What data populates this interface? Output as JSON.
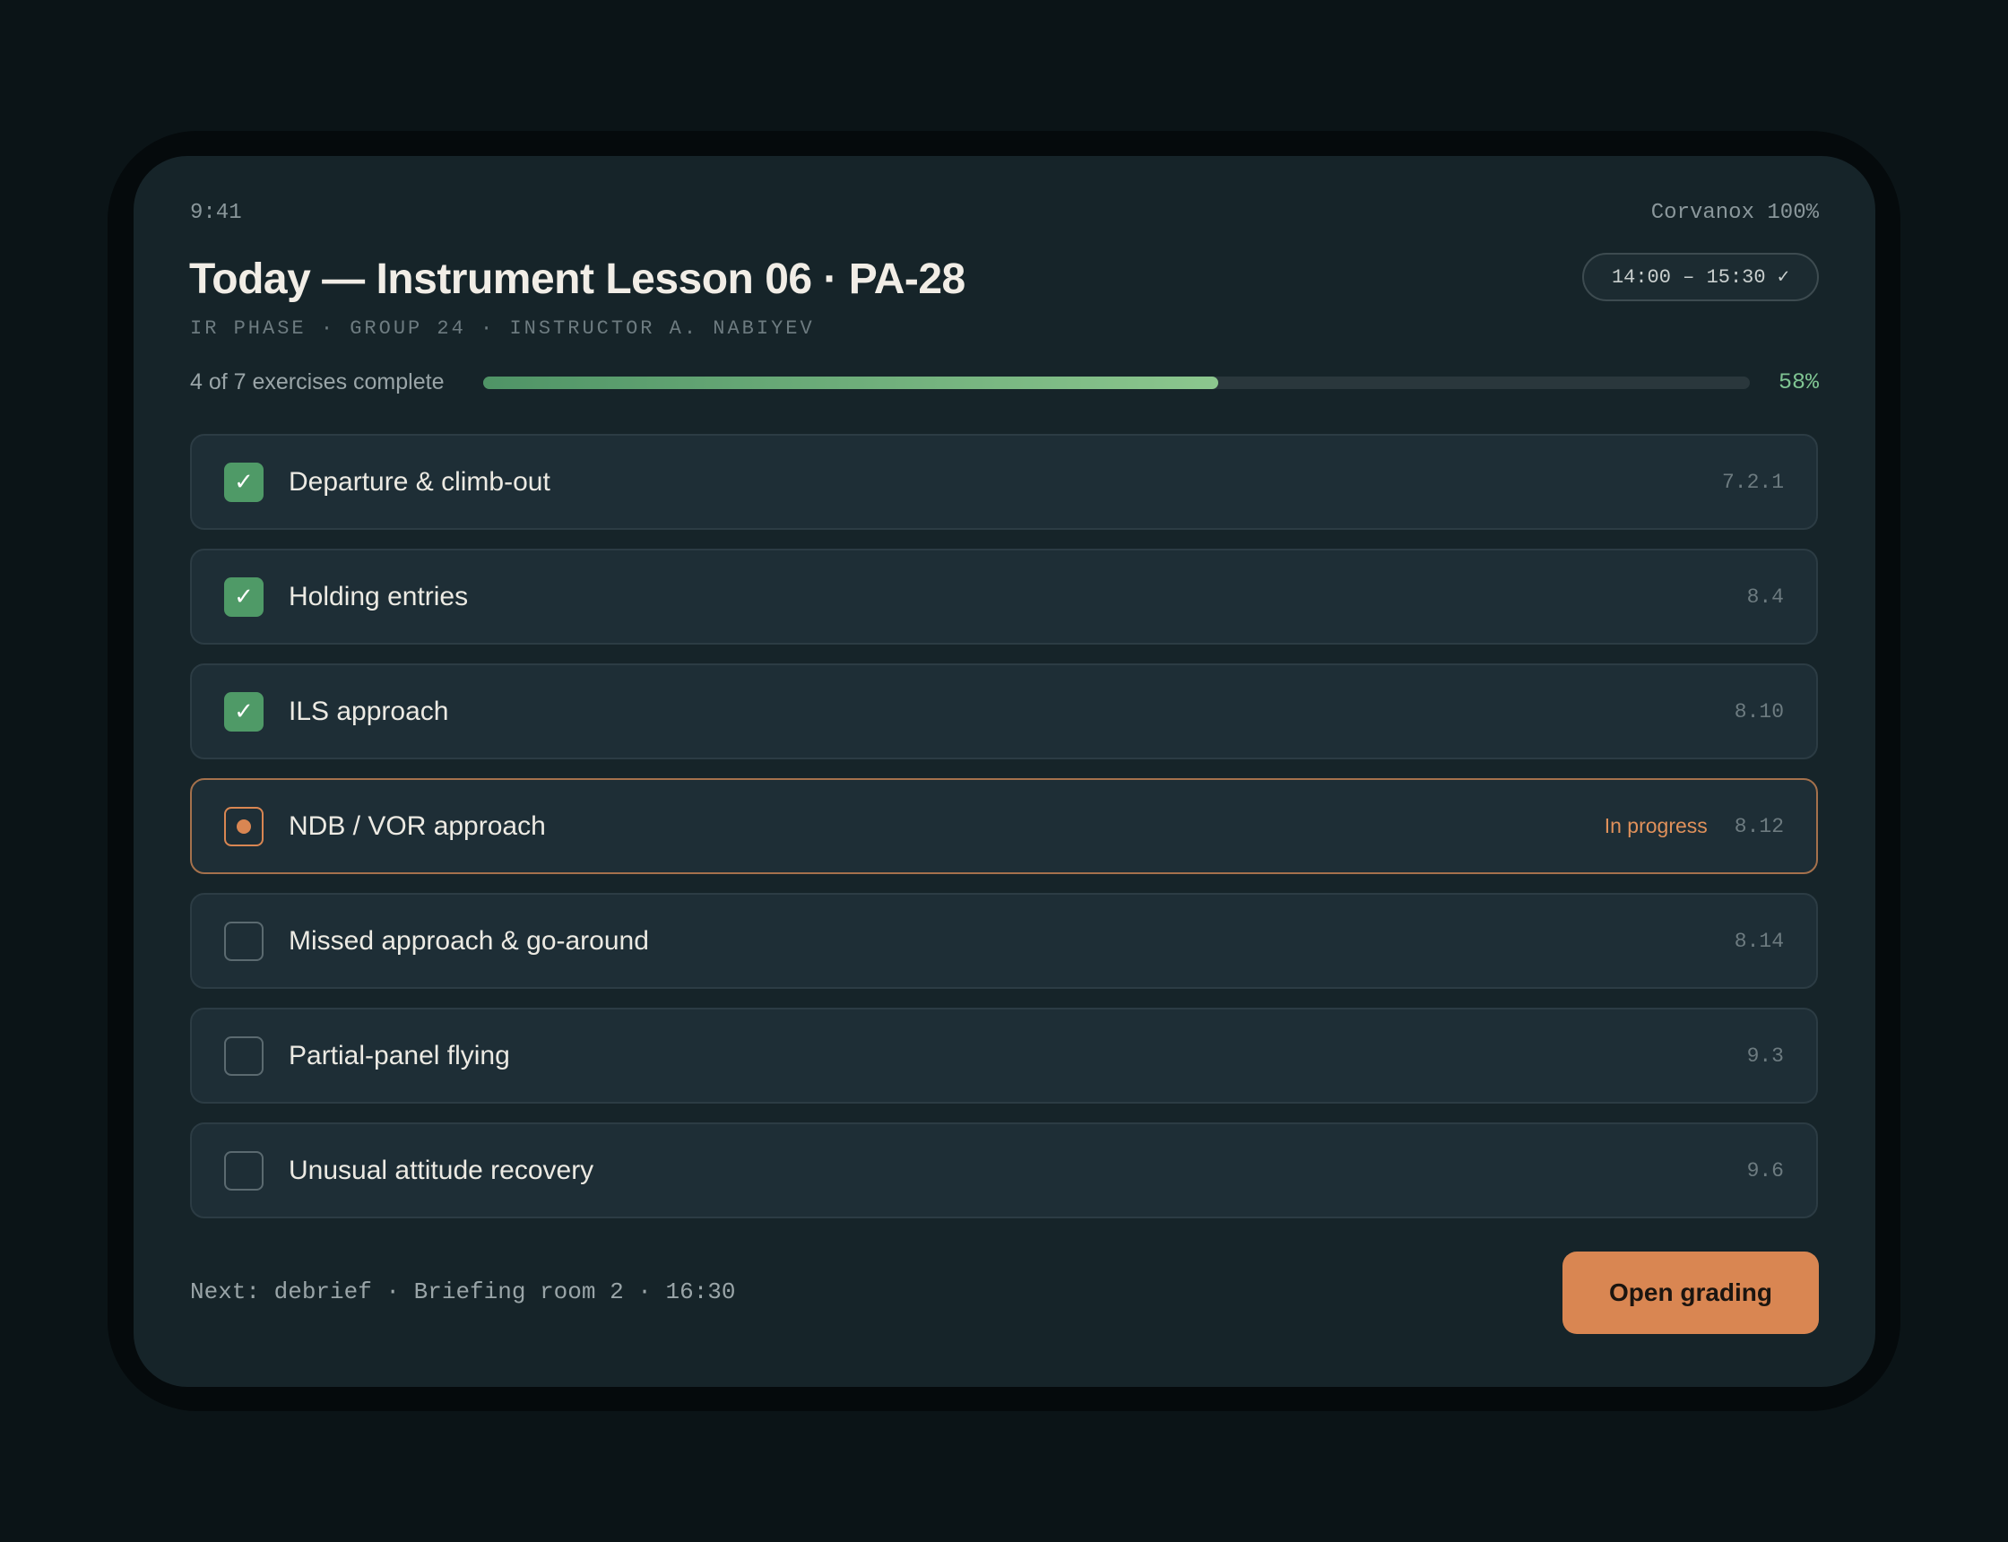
{
  "status_bar": {
    "time": "9:41",
    "right": "Corvanox 100%"
  },
  "header": {
    "title": "Today — Instrument Lesson 06 · PA-28",
    "subtitle": "IR PHASE · GROUP 24 · INSTRUCTOR A. NABIYEV",
    "time_slot": "14:00 – 15:30 ✓"
  },
  "progress": {
    "label": "4 of 7 exercises complete",
    "percent_text": "58%",
    "fraction": 0.58
  },
  "exercises": [
    {
      "label": "Departure & climb-out",
      "code": "7.2.1",
      "state": "done",
      "status": ""
    },
    {
      "label": "Holding entries",
      "code": "8.4",
      "state": "done",
      "status": ""
    },
    {
      "label": "ILS approach",
      "code": "8.10",
      "state": "done",
      "status": ""
    },
    {
      "label": "NDB / VOR approach",
      "code": "8.12",
      "state": "in-progress",
      "status": "In progress"
    },
    {
      "label": "Missed approach & go-around",
      "code": "8.14",
      "state": "todo",
      "status": ""
    },
    {
      "label": "Partial-panel flying",
      "code": "9.3",
      "state": "todo",
      "status": ""
    },
    {
      "label": "Unusual attitude recovery",
      "code": "9.6",
      "state": "todo",
      "status": ""
    }
  ],
  "footer": {
    "next": "Next: debrief · Briefing room 2 · 16:30",
    "button_label": "Open grading"
  },
  "icons": {
    "check": "check-icon",
    "dot": "in-progress-dot-icon"
  },
  "colors": {
    "accent": "#d98652",
    "success": "#4f9a67",
    "background": "#162429"
  }
}
